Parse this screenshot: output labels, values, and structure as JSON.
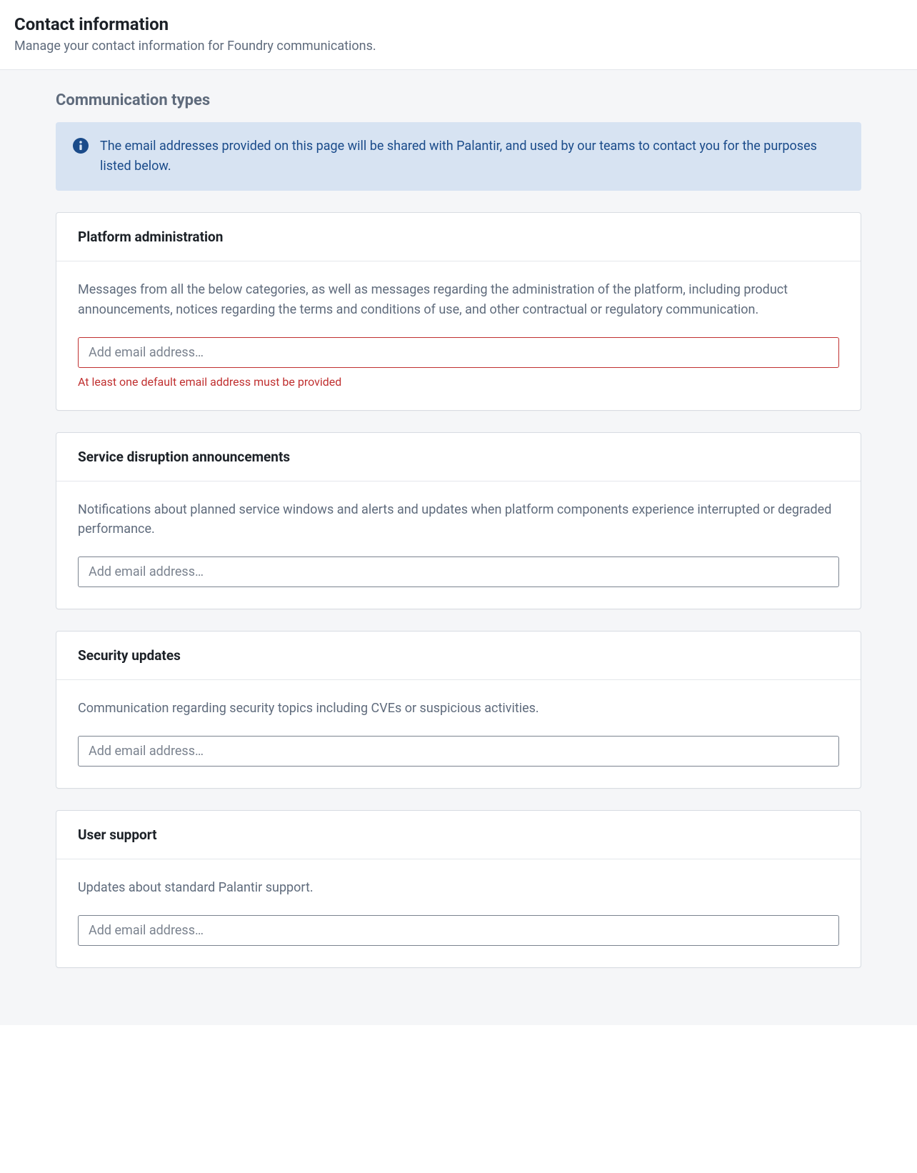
{
  "header": {
    "title": "Contact information",
    "subtitle": "Manage your contact information for Foundry communications."
  },
  "section": {
    "heading": "Communication types",
    "callout": "The email addresses provided on this page will be shared with Palantir, and used by our teams to contact you for the purposes listed below."
  },
  "categories": [
    {
      "title": "Platform administration",
      "description": "Messages from all the below categories, as well as messages regarding the administration of the platform, including product announcements, notices regarding the terms and conditions of use, and other contractual or regulatory communication.",
      "placeholder": "Add email address…",
      "error": "At least one default email address must be provided",
      "has_error": true
    },
    {
      "title": "Service disruption announcements",
      "description": "Notifications about planned service windows and alerts and updates when platform components experience interrupted or degraded performance.",
      "placeholder": "Add email address…",
      "has_error": false
    },
    {
      "title": "Security updates",
      "description": "Communication regarding security topics including CVEs or suspicious activities.",
      "placeholder": "Add email address…",
      "has_error": false
    },
    {
      "title": "User support",
      "description": "Updates about standard Palantir support.",
      "placeholder": "Add email address…",
      "has_error": false
    }
  ]
}
